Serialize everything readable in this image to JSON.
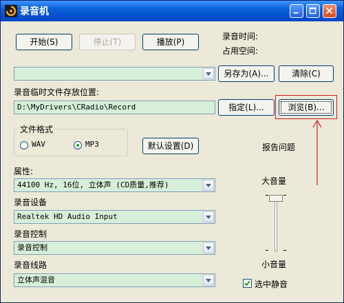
{
  "window": {
    "title": "录音机"
  },
  "toolbar": {
    "start_label": "开始(S)",
    "stop_label": "停止(T)",
    "play_label": "播放(P)"
  },
  "info": {
    "record_time_label": "录音时间:",
    "space_used_label": "占用空间:"
  },
  "file": {
    "save_as_label": "另存为(A)...",
    "clear_label": "清除(C)",
    "temp_location_label": "录音临时文件存放位置:",
    "temp_path": "D:\\MyDrivers\\CRadio\\Record",
    "assign_label": "指定(L)...",
    "browse_label": "浏览(B)..."
  },
  "format": {
    "group_label": "文件格式",
    "wav_label": "WAV",
    "mp3_label": "MP3",
    "selected": "MP3",
    "default_settings_label": "默认设置(D)"
  },
  "report_label": "报告问题",
  "properties": {
    "label": "属性:",
    "value": "44100 Hz, 16位, 立体声 (CD质量,推荐)"
  },
  "device": {
    "label": "录音设备",
    "value": "Realtek HD Audio Input"
  },
  "control": {
    "label": "录音控制",
    "value": "录音控制"
  },
  "line": {
    "label": "录音线路",
    "value": "立体声混音"
  },
  "volume": {
    "max_label": "大音量",
    "min_label": "小音量",
    "level_fraction": 1.0
  },
  "mute": {
    "label": "选中静音",
    "checked": true
  },
  "colors": {
    "field_bg": "#d7efd9",
    "annotation": "#d2191e",
    "title_bar": "#0a5fd8"
  }
}
